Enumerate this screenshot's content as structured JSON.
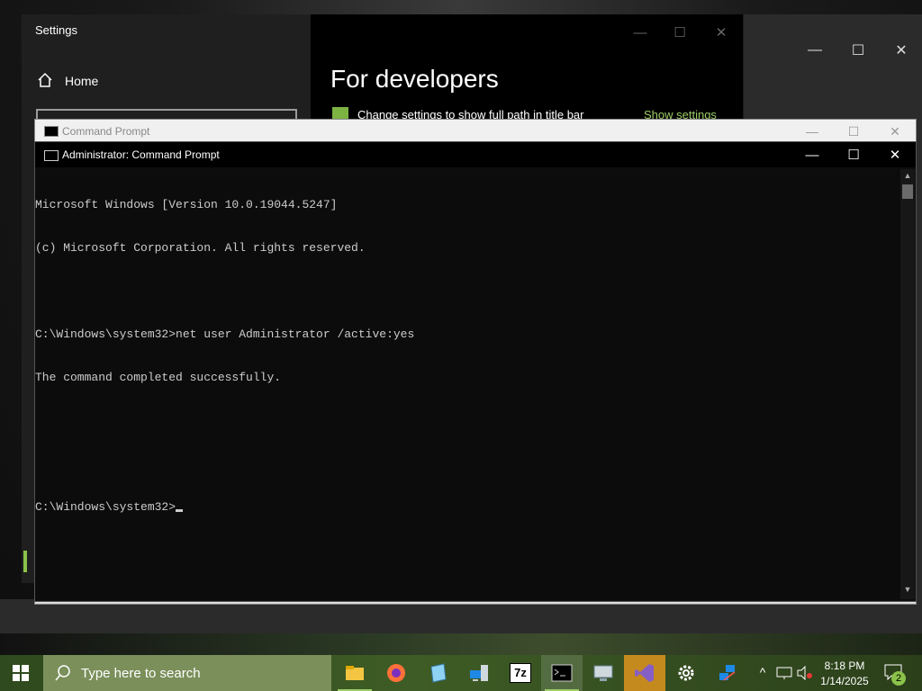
{
  "settings": {
    "title": "Settings",
    "home_label": "Home"
  },
  "developers": {
    "heading": "For developers",
    "option_label": "Change settings to show full path in title bar",
    "show_settings_link": "Show settings"
  },
  "cmd_background": {
    "title": "Command Prompt"
  },
  "cmd": {
    "title": "Administrator: Command Prompt",
    "lines": [
      "Microsoft Windows [Version 10.0.19044.5247]",
      "(c) Microsoft Corporation. All rights reserved.",
      "",
      "C:\\Windows\\system32>net user Administrator /active:yes",
      "The command completed successfully.",
      "",
      "",
      "C:\\Windows\\system32>"
    ]
  },
  "window_controls": {
    "minimize": "—",
    "maximize": "☐",
    "close": "✕"
  },
  "taskbar": {
    "search_placeholder": "Type here to search",
    "pinned": [
      {
        "name": "file-explorer-icon",
        "label": ""
      },
      {
        "name": "firefox-icon",
        "label": ""
      },
      {
        "name": "notepad-icon",
        "label": ""
      },
      {
        "name": "network-computer-icon",
        "label": ""
      },
      {
        "name": "7zip-icon",
        "label": "7z"
      },
      {
        "name": "command-prompt-icon",
        "label": ""
      },
      {
        "name": "remote-desktop-icon",
        "label": ""
      },
      {
        "name": "visual-studio-icon",
        "label": ""
      },
      {
        "name": "settings-gear-icon",
        "label": ""
      },
      {
        "name": "network-share-icon",
        "label": ""
      }
    ],
    "clock_time": "8:18 PM",
    "clock_date": "1/14/2025",
    "notification_count": "2"
  },
  "colors": {
    "accent": "#8bc34a",
    "taskbar": "#3e5c25",
    "console_bg": "#0c0c0c",
    "console_text": "#cccccc"
  }
}
